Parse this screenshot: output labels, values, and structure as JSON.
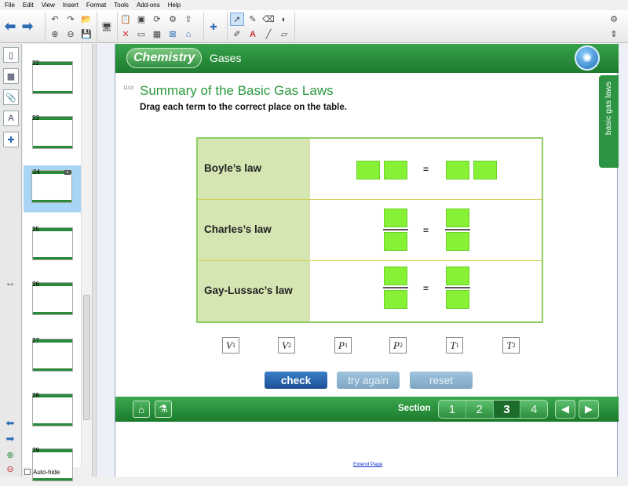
{
  "menu": [
    "File",
    "Edit",
    "View",
    "Insert",
    "Format",
    "Tools",
    "Add-ons",
    "Help"
  ],
  "sorter": {
    "thumbs": [
      {
        "num": "22",
        "selected": false
      },
      {
        "num": "23",
        "selected": false
      },
      {
        "num": "24",
        "selected": true
      },
      {
        "num": "25",
        "selected": false
      },
      {
        "num": "26",
        "selected": false
      },
      {
        "num": "27",
        "selected": false
      },
      {
        "num": "28",
        "selected": false
      },
      {
        "num": "29",
        "selected": false
      }
    ],
    "autohide_label": "Auto-hide"
  },
  "header": {
    "logo": "Chemistry",
    "subtitle": "Gases"
  },
  "page": {
    "page_number": "1103",
    "title": "Summary of the Basic Gas Laws",
    "instruction": "Drag each term to the correct place on the table.",
    "side_tab": "basic gas laws"
  },
  "table": {
    "laws": [
      "Boyle’s law",
      "Charles’s law",
      "Gay-Lussac’s law"
    ],
    "equals": "="
  },
  "terms": [
    {
      "base": "V",
      "sub": "1"
    },
    {
      "base": "V",
      "sub": "2"
    },
    {
      "base": "P",
      "sub": "1"
    },
    {
      "base": "P",
      "sub": "2"
    },
    {
      "base": "T",
      "sub": "1"
    },
    {
      "base": "T",
      "sub": "2"
    }
  ],
  "buttons": {
    "check": "check",
    "try_again": "try again",
    "reset": "reset"
  },
  "footer": {
    "section_label": "Section",
    "sections": [
      "1",
      "2",
      "3",
      "4"
    ],
    "active_section": "3"
  },
  "extend_page": "Extend Page",
  "colors": {
    "accent_green": "#2a9a3f",
    "drop_box": "#86f135",
    "check_blue": "#1c4f95"
  }
}
